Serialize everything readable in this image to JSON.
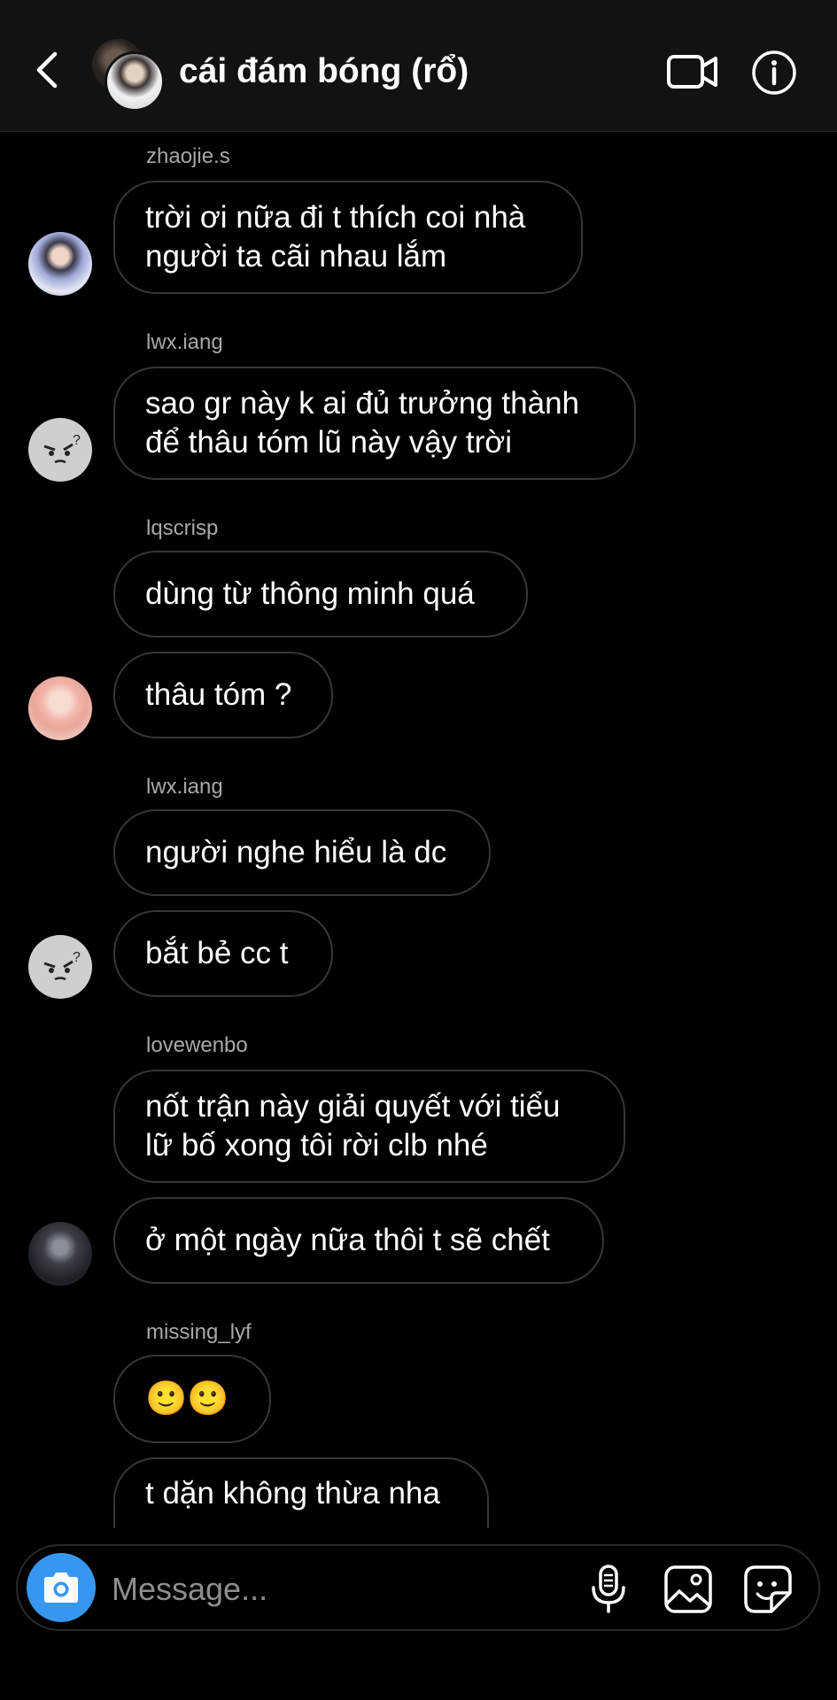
{
  "header": {
    "title": "cái đám bóng (rổ)",
    "back_icon": "chevron-left-icon",
    "video_icon": "video-call-icon",
    "info_icon": "info-icon"
  },
  "messages": [
    {
      "username": "zhaojie.s",
      "lines": [
        "trời ơi nữa đi t thích coi nhà",
        "người ta cãi nhau lắm"
      ]
    },
    {
      "username": "lwx.iang",
      "lines": [
        "sao gr này k ai đủ trưởng thành",
        "để thâu tóm lũ này vậy trời"
      ]
    },
    {
      "username": "lqscrisp",
      "lines": [
        "dùng từ thông minh quá"
      ]
    },
    {
      "lines": [
        "thâu tóm ?"
      ]
    },
    {
      "username": "lwx.iang",
      "lines": [
        "người nghe hiểu là dc"
      ]
    },
    {
      "lines": [
        "bắt bẻ cc t"
      ]
    },
    {
      "username": "lovewenbo",
      "lines": [
        "nốt trận này giải quyết với tiểu",
        "lữ bố xong tôi rời clb nhé"
      ]
    },
    {
      "lines": [
        "ở một ngày nữa thôi t sẽ chết"
      ]
    },
    {
      "username": "missing_lyf",
      "lines": [
        "🙂🙂"
      ]
    },
    {
      "lines": [
        "t dặn không thừa nha"
      ]
    }
  ],
  "composer": {
    "placeholder": "Message...",
    "camera_icon": "camera-icon",
    "mic_icon": "microphone-icon",
    "gallery_icon": "gallery-icon",
    "sticker_icon": "sticker-icon"
  },
  "colors": {
    "background": "#000000",
    "header_bg": "#121212",
    "bubble_border": "#363636",
    "username": "#a8a8a8",
    "accent": "#3797f0"
  }
}
